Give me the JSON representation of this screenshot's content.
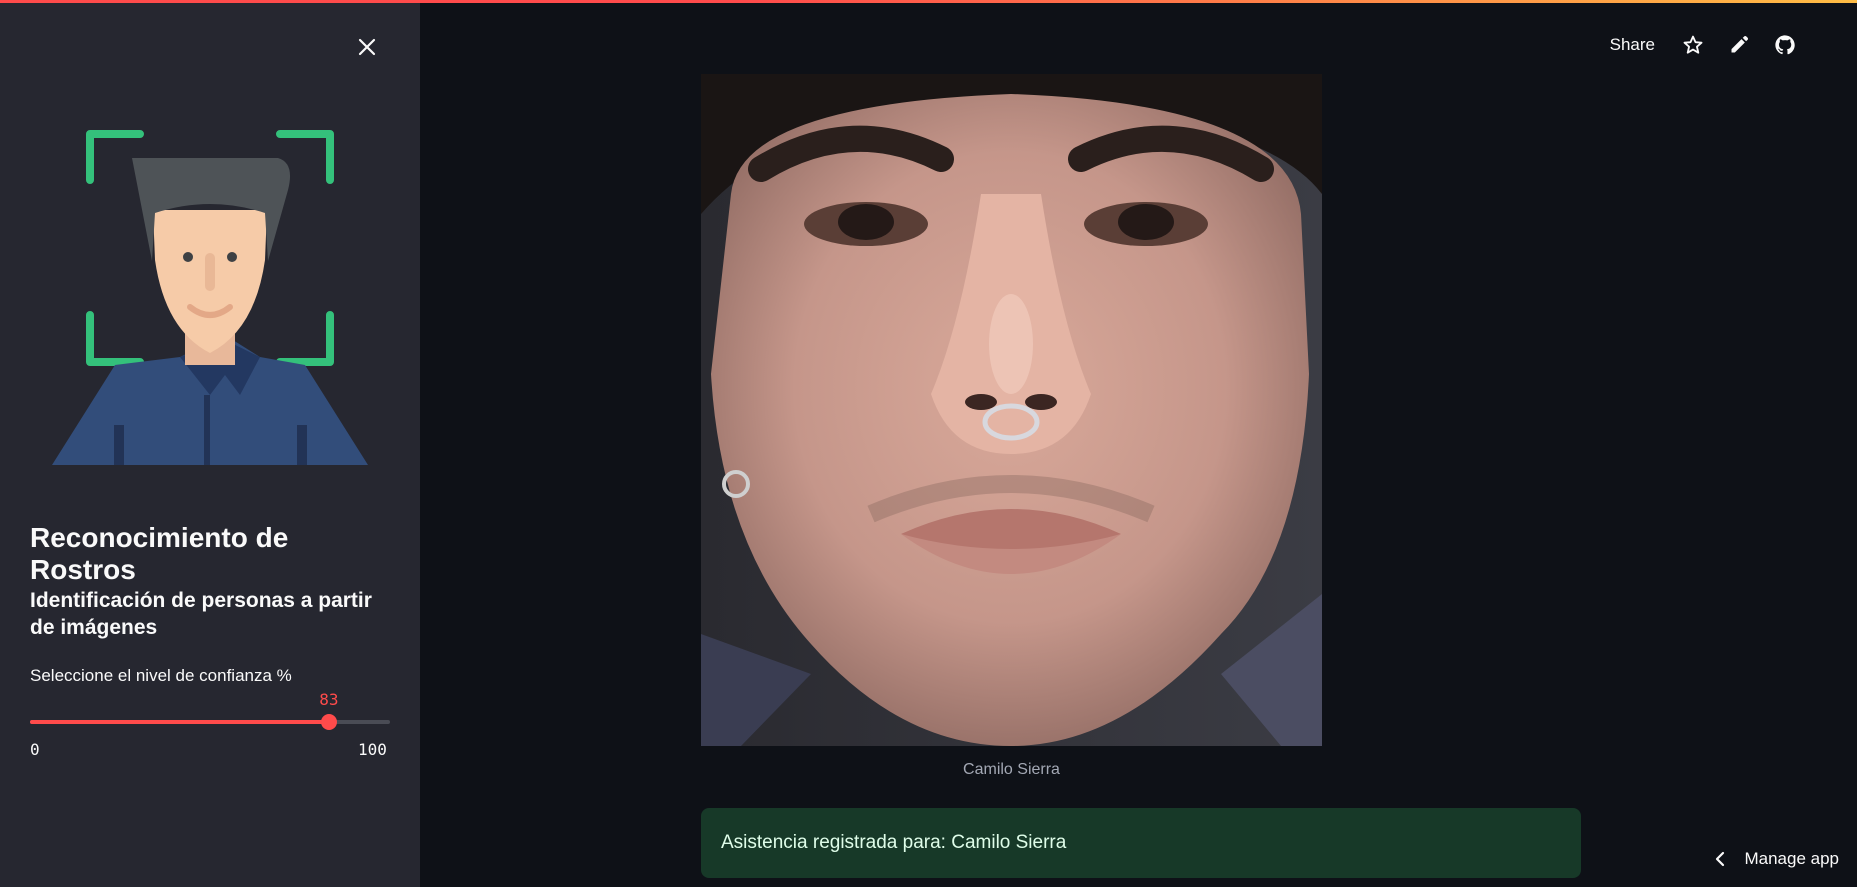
{
  "header": {
    "share_label": "Share"
  },
  "sidebar": {
    "title": "Reconocimiento de Rostros",
    "subtitle": "Identificación de personas a partir de imágenes",
    "slider": {
      "label": "Seleccione el nivel de confianza %",
      "value": 83,
      "value_text": "83",
      "min": 0,
      "max": 100,
      "min_text": "0",
      "max_text": "100"
    }
  },
  "main": {
    "image_caption": "Camilo Sierra",
    "success_message": "Asistencia registrada para: Camilo Sierra"
  },
  "footer": {
    "manage_app_label": "Manage app"
  },
  "icons": [
    "close-icon",
    "star-icon",
    "edit-icon",
    "github-icon",
    "chevron-left-icon",
    "face-recognition-icon"
  ],
  "colors": {
    "accent": "#ff4b4b",
    "sidebar_bg": "#262730",
    "main_bg": "#0e1117",
    "success_bg": "#173928",
    "success_text": "#dffde9",
    "frame_green": "#34c17b"
  }
}
